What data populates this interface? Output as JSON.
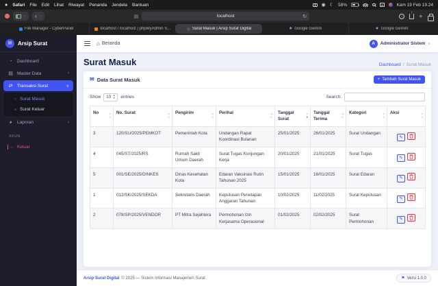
{
  "icons": {
    "apple": "●",
    "chevron_down": "∨",
    "chevron_left": "‹",
    "back_arrow": "‹",
    "forward_arrow": "›",
    "reader": "▤",
    "reload": "↻",
    "download_arrow": "↓",
    "new_tab": "+",
    "moon": "☾",
    "shield": "◉",
    "gemini_star": "★",
    "envelope": "✉",
    "gauge": "◔",
    "database": "▤",
    "exchange": "⇄",
    "pie": "◕",
    "bullet": "○",
    "home": "⌂",
    "pencil": "✎",
    "sort_up": "▲",
    "sort_down": "▼",
    "logout_arrow": "→",
    "flag": "⚑",
    "plus": "+"
  },
  "menubar": {
    "items": [
      "Safari",
      "File",
      "Edit",
      "Lihat",
      "Riwayat",
      "Penanda",
      "Jendela",
      "Bantuan"
    ],
    "battery_percent": "58%",
    "clock": "Kam 19 Feb 19.24"
  },
  "browser": {
    "url": "localhost",
    "tabs": [
      {
        "label": "File Manager - CyberPanel"
      },
      {
        "label": "localhost / localhost | phpMyAdmin S..."
      },
      {
        "label": "Surat Masuk | Arsip Surat Digital"
      },
      {
        "label": "Google Gemini"
      },
      {
        "label": "Google Gemini"
      }
    ]
  },
  "sidebar": {
    "brand": "Arsip Surat",
    "items": [
      {
        "label": "Dashboard"
      },
      {
        "label": "Master Data"
      },
      {
        "label": "Transaksi Surat"
      },
      {
        "label": "Surat Masuk"
      },
      {
        "label": "Surat Keluar"
      },
      {
        "label": "Laporan"
      }
    ],
    "section_label": "AKUN",
    "logout_label": "Keluar"
  },
  "topbar": {
    "home_label": "Beranda",
    "avatar_initial": "A",
    "user_name": "Administrator Sistem"
  },
  "page": {
    "title": "Surat Masuk",
    "breadcrumb_link": "Dashboard",
    "breadcrumb_sep": "/",
    "breadcrumb_current": "Surat Masuk"
  },
  "card": {
    "title": "Data Surat Masuk",
    "add_button": "Tambah Surat Masuk",
    "show_label": "Show",
    "page_size": "10",
    "entries_label": "entries",
    "search_label": "Search:"
  },
  "table": {
    "headers": [
      "No",
      "No. Surat",
      "Pengirim",
      "Perihal",
      "Tanggal Surat",
      "Tanggal Terima",
      "Kategori",
      "Aksi"
    ],
    "rows": [
      {
        "no": "3",
        "no_surat": "120/SU/2025/PEMKOT",
        "pengirim": "Pemerintah Kota",
        "perihal": "Undangan Rapat Koordinasi Bulanan",
        "tanggal_surat": "25/01/2025",
        "tanggal_terima": "26/01/2025",
        "kategori": "Surat Undangan"
      },
      {
        "no": "4",
        "no_surat": "045/ST/2025/RS",
        "pengirim": "Rumah Sakit Umum Daerah",
        "perihal": "Surat Tugas Kunjungan Kerja",
        "tanggal_surat": "20/01/2025",
        "tanggal_terima": "21/01/2025",
        "kategori": "Surat Tugas"
      },
      {
        "no": "5",
        "no_surat": "001/SE/2025/DINKES",
        "pengirim": "Dinas Kesehatan Kota",
        "perihal": "Edaran Vaksinasi Rutin Tahunan 2025",
        "tanggal_surat": "15/01/2025",
        "tanggal_terima": "16/01/2025",
        "kategori": "Surat Edaran"
      },
      {
        "no": "1",
        "no_surat": "012/SK/2025/SEKDA",
        "pengirim": "Sekretaris Daerah",
        "perihal": "Keputusan Penetapan Anggaran Tahunan",
        "tanggal_surat": "10/02/2025",
        "tanggal_terima": "11/02/2025",
        "kategori": "Surat Keputusan"
      },
      {
        "no": "2",
        "no_surat": "078/SP/2025/VENDOR",
        "pengirim": "PT Mitra Sejahtera",
        "perihal": "Permohonan Izin Kerjasama Operasional",
        "tanggal_surat": "01/02/2025",
        "tanggal_terima": "02/02/2025",
        "kategori": "Surat Permohonan"
      }
    ]
  },
  "footer": {
    "brand": "Arsip Surat Digital",
    "text": "© 2025 — Sistem Informasi Manajemen Surat",
    "version": "Versi 1.0.0"
  },
  "colors": {
    "primary": "#4154f1",
    "sidebar_bg": "#1d1d2b",
    "danger": "#dc3545"
  }
}
